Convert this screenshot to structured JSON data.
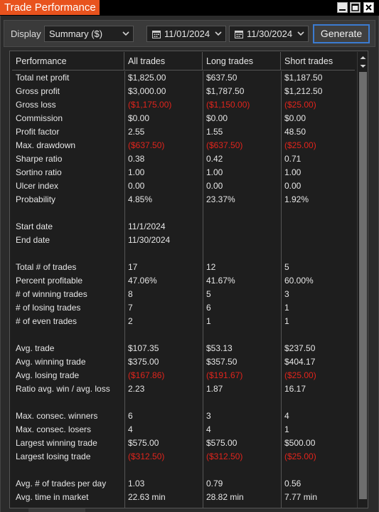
{
  "window": {
    "title": "Trade Performance",
    "accent_color": "#e8531e",
    "controls": [
      "minimize-icon",
      "maximize-icon",
      "close-icon"
    ]
  },
  "toolbar": {
    "display_label": "Display",
    "display_value": "Summary ($)",
    "start_date": "11/01/2024",
    "end_date": "11/30/2024",
    "generate_label": "Generate"
  },
  "table": {
    "headers": [
      "Performance",
      "All trades",
      "Long trades",
      "Short trades"
    ],
    "negative_color": "#e0241c",
    "rows": [
      {
        "label": "Total net profit",
        "all": "$1,825.00",
        "long": "$637.50",
        "short": "$1,187.50"
      },
      {
        "label": "Gross profit",
        "all": "$3,000.00",
        "long": "$1,787.50",
        "short": "$1,212.50"
      },
      {
        "label": "Gross loss",
        "all": "($1,175.00)",
        "long": "($1,150.00)",
        "short": "($25.00)"
      },
      {
        "label": "Commission",
        "all": "$0.00",
        "long": "$0.00",
        "short": "$0.00"
      },
      {
        "label": "Profit factor",
        "all": "2.55",
        "long": "1.55",
        "short": "48.50"
      },
      {
        "label": "Max. drawdown",
        "all": "($637.50)",
        "long": "($637.50)",
        "short": "($25.00)"
      },
      {
        "label": "Sharpe ratio",
        "all": "0.38",
        "long": "0.42",
        "short": "0.71"
      },
      {
        "label": "Sortino ratio",
        "all": "1.00",
        "long": "1.00",
        "short": "1.00"
      },
      {
        "label": "Ulcer index",
        "all": "0.00",
        "long": "0.00",
        "short": "0.00"
      },
      {
        "label": "Probability",
        "all": "4.85%",
        "long": "23.37%",
        "short": "1.92%"
      },
      {
        "label": "",
        "all": "",
        "long": "",
        "short": ""
      },
      {
        "label": "Start date",
        "all": "11/1/2024",
        "long": "",
        "short": ""
      },
      {
        "label": "End date",
        "all": "11/30/2024",
        "long": "",
        "short": ""
      },
      {
        "label": "",
        "all": "",
        "long": "",
        "short": ""
      },
      {
        "label": "Total # of trades",
        "all": "17",
        "long": "12",
        "short": "5"
      },
      {
        "label": "Percent profitable",
        "all": "47.06%",
        "long": "41.67%",
        "short": "60.00%"
      },
      {
        "label": "# of winning trades",
        "all": "8",
        "long": "5",
        "short": "3"
      },
      {
        "label": "# of losing trades",
        "all": "7",
        "long": "6",
        "short": "1"
      },
      {
        "label": "# of even trades",
        "all": "2",
        "long": "1",
        "short": "1"
      },
      {
        "label": "",
        "all": "",
        "long": "",
        "short": ""
      },
      {
        "label": "Avg. trade",
        "all": "$107.35",
        "long": "$53.13",
        "short": "$237.50"
      },
      {
        "label": "Avg. winning trade",
        "all": "$375.00",
        "long": "$357.50",
        "short": "$404.17"
      },
      {
        "label": "Avg. losing trade",
        "all": "($167.86)",
        "long": "($191.67)",
        "short": "($25.00)"
      },
      {
        "label": "Ratio avg. win / avg. loss",
        "all": "2.23",
        "long": "1.87",
        "short": "16.17"
      },
      {
        "label": "",
        "all": "",
        "long": "",
        "short": ""
      },
      {
        "label": "Max. consec. winners",
        "all": "6",
        "long": "3",
        "short": "4"
      },
      {
        "label": "Max. consec. losers",
        "all": "4",
        "long": "4",
        "short": "1"
      },
      {
        "label": "Largest winning trade",
        "all": "$575.00",
        "long": "$575.00",
        "short": "$500.00"
      },
      {
        "label": "Largest losing trade",
        "all": "($312.50)",
        "long": "($312.50)",
        "short": "($25.00)"
      },
      {
        "label": "",
        "all": "",
        "long": "",
        "short": ""
      },
      {
        "label": "Avg. # of trades per day",
        "all": "1.03",
        "long": "0.79",
        "short": "0.56"
      },
      {
        "label": "Avg. time in market",
        "all": "22.63 min",
        "long": "28.82 min",
        "short": "7.77 min"
      }
    ]
  }
}
